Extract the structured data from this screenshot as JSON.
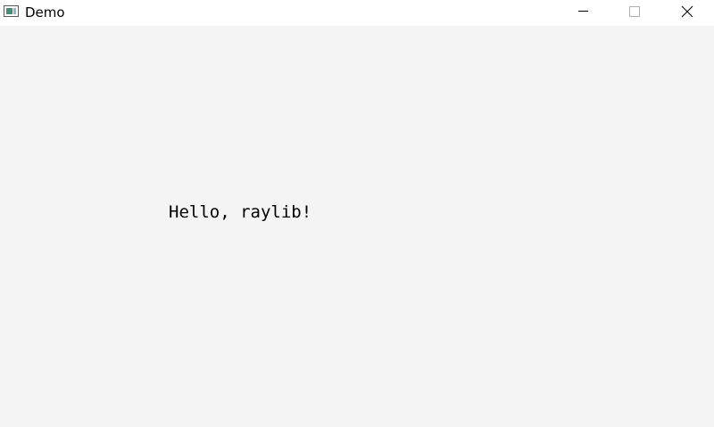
{
  "window": {
    "title": "Demo",
    "app_icon": "window-app-icon",
    "controls": {
      "minimize_icon": "minimize-icon",
      "maximize_icon": "maximize-icon",
      "close_icon": "close-icon"
    }
  },
  "content": {
    "text": "Hello, raylib!",
    "background_color": "#f4f4f4",
    "text_color": "#000000"
  }
}
